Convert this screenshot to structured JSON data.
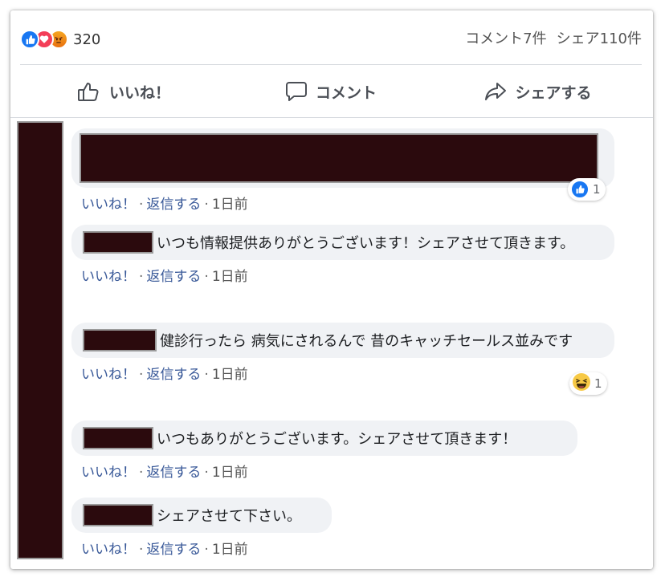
{
  "summary": {
    "reaction_icons": [
      "like-icon",
      "love-icon",
      "angry-icon"
    ],
    "reaction_count": "320",
    "comments": "コメント7件",
    "shares": "シェア110件"
  },
  "actions": {
    "like": "いいね！",
    "comment": "コメント",
    "share": "シェアする"
  },
  "comments": [
    {
      "text": "",
      "reaction_icon": "like-icon",
      "reaction_count": "1",
      "like": "いいね！",
      "reply": "返信する",
      "time": "1日前"
    },
    {
      "text": "いつも情報提供ありがとうございます！シェアさせて頂きます。",
      "like": "いいね！",
      "reply": "返信する",
      "time": "1日前"
    },
    {
      "text": "健診行ったら 病気にされるんで 昔のキャッチセールス並みです",
      "reaction_icon": "laugh-icon",
      "reaction_count": "1",
      "like": "いいね！",
      "reply": "返信する",
      "time": "1日前"
    },
    {
      "text": "いつもありがとうございます。シェアさせて頂きます！",
      "like": "いいね！",
      "reply": "返信する",
      "time": "1日前"
    },
    {
      "text": "シェアさせて下さい。",
      "like": "いいね！",
      "reply": "返信する",
      "time": "1日前"
    }
  ],
  "colors": {
    "like": "#1877f2",
    "love": "#f33e58",
    "link": "#385898",
    "redaction": "#2b0a0d"
  }
}
